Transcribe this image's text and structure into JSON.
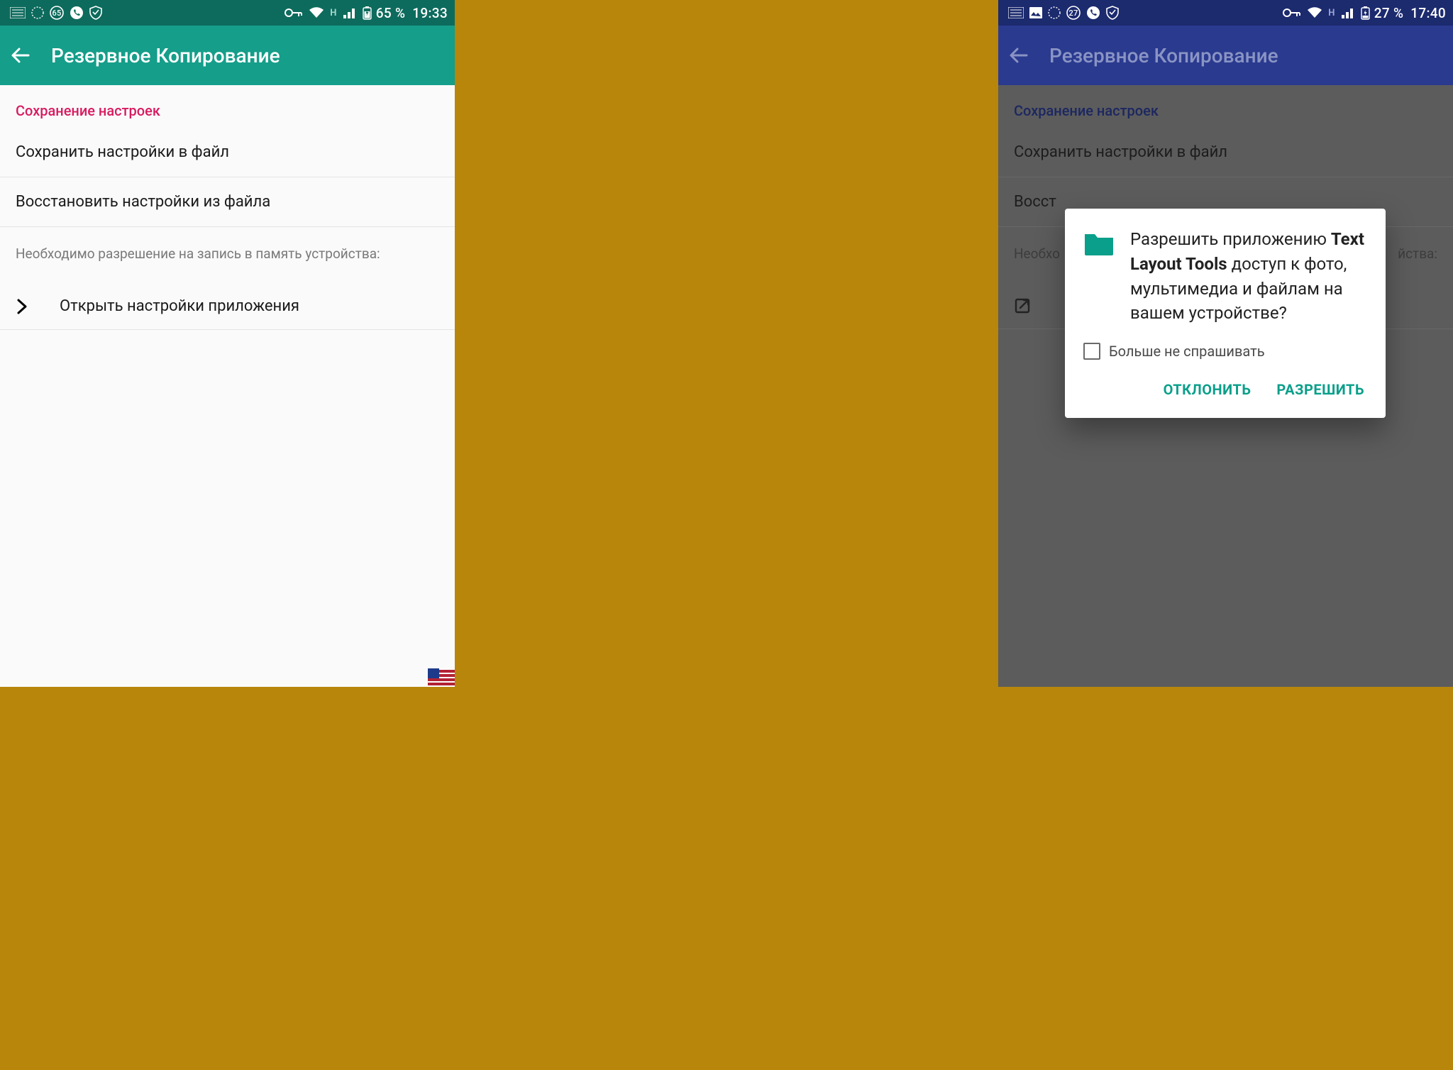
{
  "left": {
    "status": {
      "battery": "65 %",
      "time": "19:33",
      "badge": "65"
    },
    "toolbar": {
      "title": "Резервное Копирование"
    },
    "section_title": "Сохранение настроек",
    "rows": {
      "save": "Сохранить настройки в файл",
      "restore": "Восстановить настройки из файла"
    },
    "hint": "Необходимо разрешение на запись в память устройства:",
    "nav": {
      "label": "Открыть настройки приложения"
    }
  },
  "right": {
    "status": {
      "battery": "27 %",
      "time": "17:40",
      "badge": "27"
    },
    "toolbar": {
      "title": "Резервное Копирование"
    },
    "section_title": "Сохранение настроек",
    "rows": {
      "save": "Сохранить настройки в файл",
      "restore_prefix": "Восст"
    },
    "hint_prefix": "Необхо",
    "hint_suffix": "йства:",
    "dialog": {
      "msg_prefix": "Разрешить приложению ",
      "msg_bold": "Text Layout Tools",
      "msg_suffix": " доступ к фото, мультимедиа и файлам на вашем устройстве?",
      "dont_ask": "Больше не спрашивать",
      "deny": "ОТКЛОНИТЬ",
      "allow": "РАЗРЕШИТЬ"
    }
  },
  "colors": {
    "teal_dark": "#0d6b5d",
    "teal": "#159e8a",
    "indigo_dark": "#1c2a6e",
    "indigo": "#2a3a8f",
    "accent_teal_text": "#0a9f8a",
    "pink": "#d81b60"
  }
}
